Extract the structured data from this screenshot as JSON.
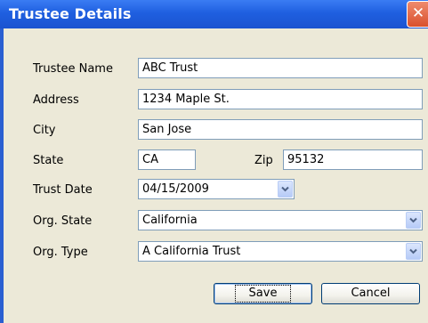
{
  "window": {
    "title": "Trustee Details",
    "close_glyph": "✕"
  },
  "form": {
    "trustee_name": {
      "label": "Trustee Name",
      "value": "ABC Trust"
    },
    "address": {
      "label": "Address",
      "value": "1234 Maple St."
    },
    "city": {
      "label": "City",
      "value": "San Jose"
    },
    "state": {
      "label": "State",
      "value": "CA"
    },
    "zip": {
      "label": "Zip",
      "value": "95132"
    },
    "trust_date": {
      "label": "Trust Date",
      "value": "04/15/2009"
    },
    "org_state": {
      "label": "Org. State",
      "value": "California"
    },
    "org_type": {
      "label": "Org. Type",
      "value": "A California Trust"
    }
  },
  "buttons": {
    "save": "Save",
    "cancel": "Cancel"
  },
  "icons": {
    "close": "close-icon",
    "dropdown": "chevron-down-icon"
  },
  "colors": {
    "titlebar": "#1f5fe0",
    "dialog_bg": "#ece9d8",
    "close_button": "#d9512d"
  }
}
